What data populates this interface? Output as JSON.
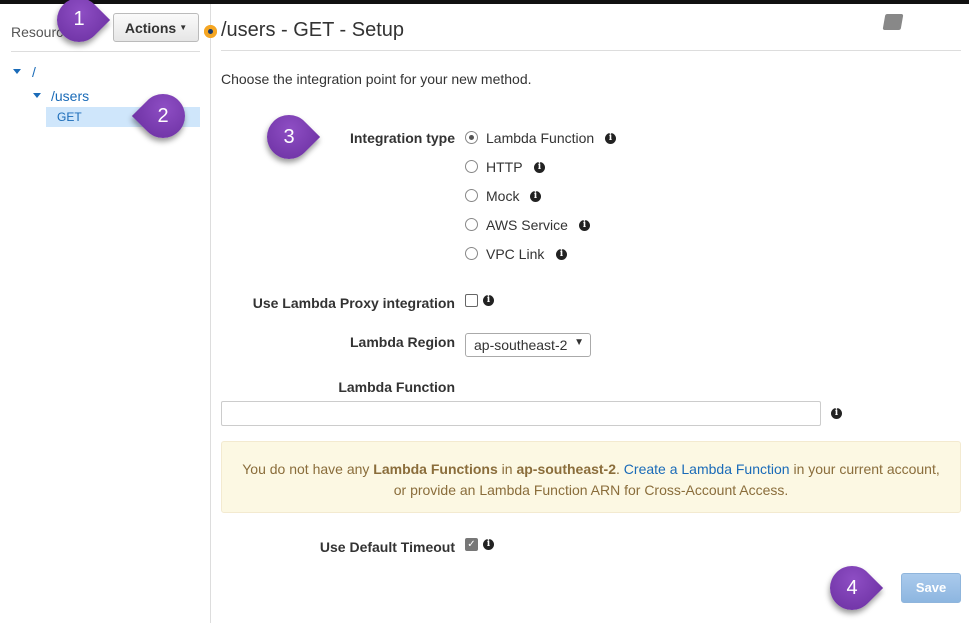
{
  "sidebar": {
    "title": "Resources",
    "actions_label": "Actions",
    "tree": [
      {
        "label": "/"
      },
      {
        "label": "/users"
      },
      {
        "label": "GET"
      }
    ]
  },
  "main": {
    "title": "/users - GET - Setup",
    "intro": "Choose the integration point for your new method.",
    "integration_type_label": "Integration type",
    "integration_options": [
      {
        "label": "Lambda Function",
        "selected": true
      },
      {
        "label": "HTTP",
        "selected": false
      },
      {
        "label": "Mock",
        "selected": false
      },
      {
        "label": "AWS Service",
        "selected": false
      },
      {
        "label": "VPC Link",
        "selected": false
      }
    ],
    "proxy_label": "Use Lambda Proxy integration",
    "proxy_checked": false,
    "region_label": "Lambda Region",
    "region_value": "ap-southeast-2",
    "function_label": "Lambda Function",
    "function_value": "",
    "alert": {
      "t1": "You do not have any ",
      "b1": "Lambda Functions",
      "t2": " in ",
      "b2": "ap-southeast-2",
      "t3": ". ",
      "link": "Create a Lambda Function",
      "t4": " in your current account,",
      "line2": "or provide an Lambda Function ARN for Cross-Account Access."
    },
    "timeout_label": "Use Default Timeout",
    "timeout_checked": true,
    "save_label": "Save"
  },
  "callouts": [
    "1",
    "2",
    "3",
    "4"
  ],
  "colors": {
    "accent": "#1a6bb8",
    "callout": "#7b3fb3",
    "alert_bg": "#fcf8e3"
  }
}
